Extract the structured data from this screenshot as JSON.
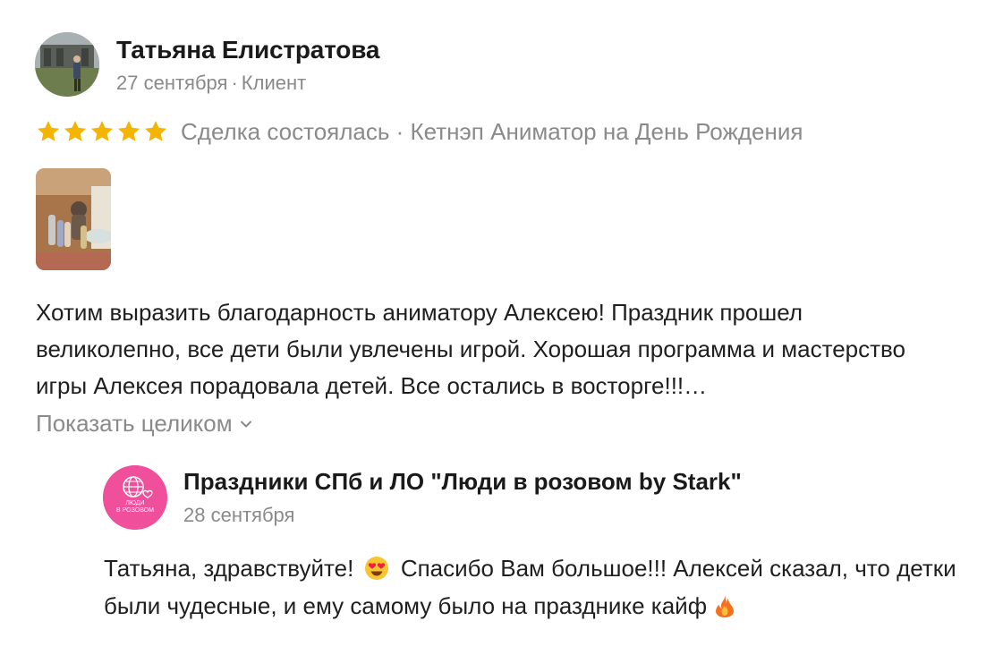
{
  "review": {
    "author": {
      "name": "Татьяна Елистратова",
      "date": "27 сентября",
      "separator": "·",
      "role": "Клиент",
      "avatar_icon": "user-photo"
    },
    "rating": {
      "stars": 5,
      "star_color": "#f5b400",
      "status": "Сделка состоялась · Кетнэп Аниматор на День Рождения"
    },
    "photo_icon": "review-photo-thumbnail",
    "text": "Хотим выразить благодарность аниматору Алексею! Праздник прошел великолепно, все дети были увлечены игрой. Хорошая программа и мастерство игры Алексея порадовала детей. Все остались в восторге!!!…",
    "show_more_label": "Показать целиком"
  },
  "reply": {
    "author": {
      "name": "Праздники СПб и ЛО \"Люди в розовом by Stark\"",
      "date": "28 сентября",
      "logo_line1": "ЛЮДИ",
      "logo_line2": "В РОЗОВОМ",
      "logo_color": "#ef4f9b"
    },
    "text_part1": "Татьяна, здравствуйте!",
    "emoji1": "heart-eyes-emoji",
    "text_part2": "Спасибо Вам большое!!! Алексей сказал, что детки были чудесные, и ему самому было на празднике кайф",
    "emoji2": "fire-emoji"
  }
}
